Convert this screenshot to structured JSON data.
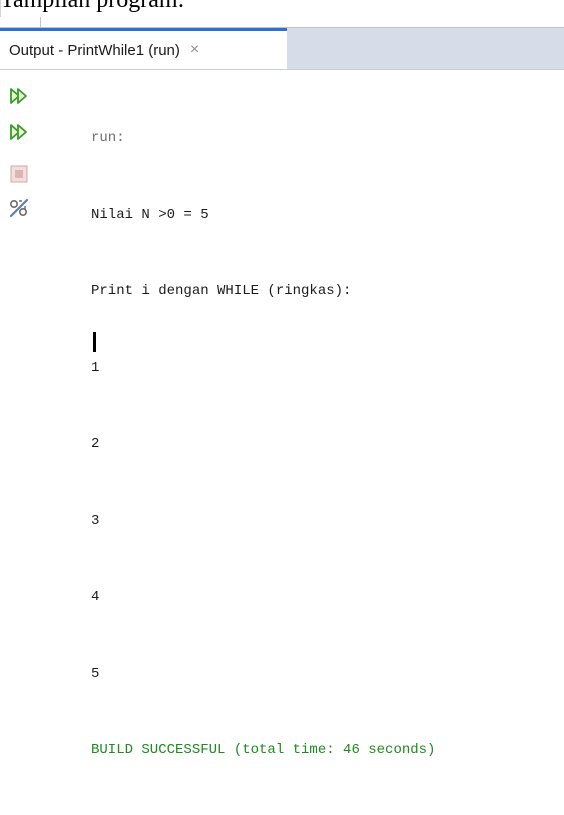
{
  "doc": {
    "caption": "Tampilan program:"
  },
  "output_window": {
    "tab": {
      "label": "Output - PrintWhile1 (run)",
      "close_glyph": "×"
    },
    "toolbar": [
      {
        "name": "rerun-icon",
        "color": "#3a9a2a"
      },
      {
        "name": "rerun-with-options-icon",
        "color": "#3a9a2a"
      },
      {
        "name": "stop-icon",
        "color": "#d9a6a6"
      },
      {
        "name": "settings-icon",
        "color": "#5f7fa8"
      }
    ],
    "console_lines": [
      {
        "text": "run:",
        "kind": "meta"
      },
      {
        "text": "Nilai N >0 = 5",
        "kind": "out"
      },
      {
        "text": "Print i dengan WHILE (ringkas):",
        "kind": "out"
      },
      {
        "text": "1",
        "kind": "out"
      },
      {
        "text": "2",
        "kind": "out"
      },
      {
        "text": "3",
        "kind": "out"
      },
      {
        "text": "4",
        "kind": "out"
      },
      {
        "text": "5",
        "kind": "out"
      },
      {
        "text": "BUILD SUCCESSFUL (total time: 46 seconds)",
        "kind": "ok"
      }
    ]
  }
}
